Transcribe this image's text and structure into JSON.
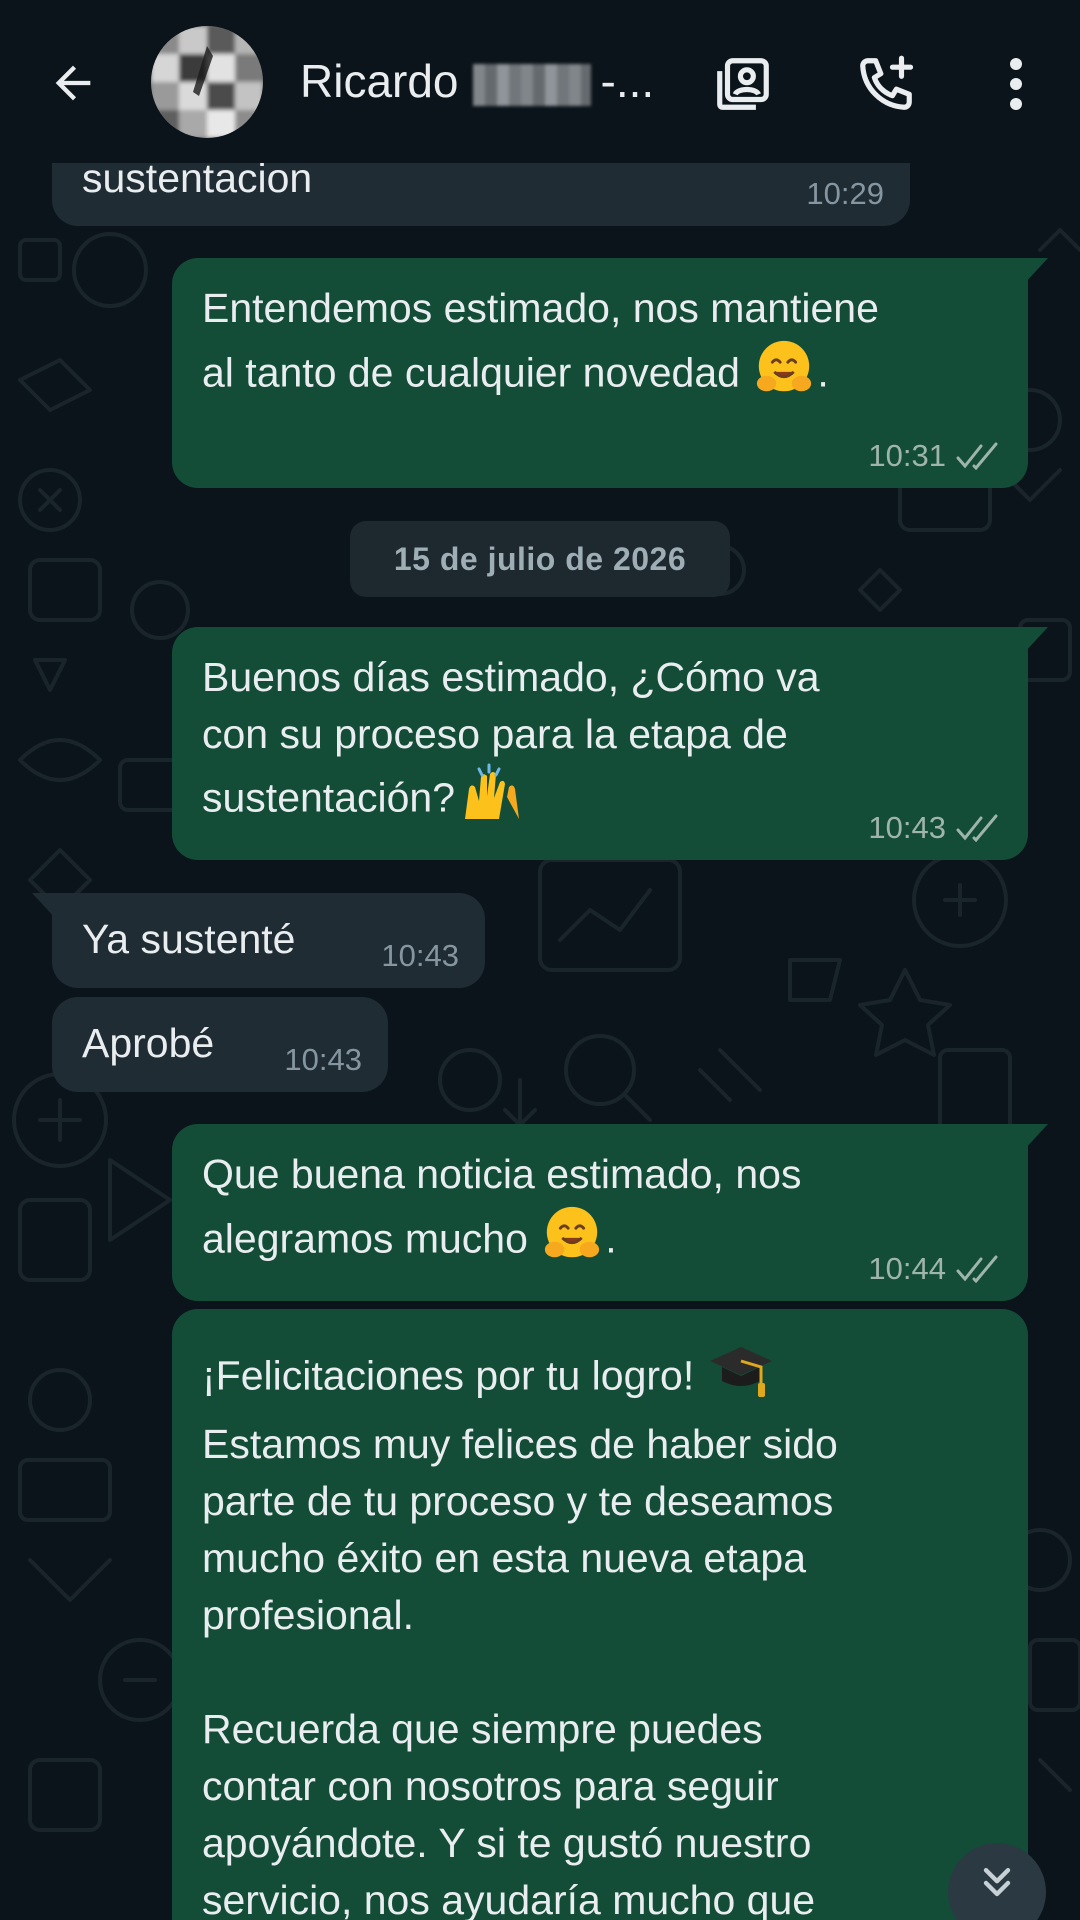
{
  "header": {
    "contact_name": "Ricardo",
    "contact_suffix": "-...",
    "back_icon": "arrow-back-icon",
    "avatar_icon": "avatar",
    "actions": [
      "contact-card-icon",
      "add-call-icon",
      "more-vert-icon"
    ]
  },
  "messages": [
    {
      "direction": "in",
      "text": "sustentacion",
      "time": "10:29"
    },
    {
      "direction": "out",
      "text_line1": "Entendemos estimado, nos mantiene",
      "text_line2": "al tanto de cualquier novedad",
      "suffix": ".",
      "time": "10:31",
      "status": "read"
    },
    {
      "direction": "out",
      "text_line1": "Buenos días estimado, ¿Cómo va",
      "text_line2": "con su proceso para la etapa de",
      "text_line3": "sustentación?",
      "time": "10:43",
      "status": "read"
    },
    {
      "direction": "in",
      "text": "Ya sustenté",
      "time": "10:43"
    },
    {
      "direction": "in",
      "text": "Aprobé",
      "time": "10:43"
    },
    {
      "direction": "out",
      "text_line1": "Que buena noticia estimado, nos",
      "text_line2": "alegramos mucho",
      "suffix": ".",
      "time": "10:44",
      "status": "read"
    },
    {
      "direction": "out",
      "text_line1": "¡Felicitaciones por tu logro!",
      "text_rest": "Estamos muy felices de haber sido\nparte de tu proceso y te deseamos\nmucho éxito en esta nueva etapa\nprofesional.\n\nRecuerda que siempre puedes\ncontar con nosotros para seguir\napoyándote. Y si te gustó nuestro\nservicio, nos ayudaría mucho que"
    }
  ],
  "date_chip": "15 de julio de 2026",
  "emojis": [
    "hugging-face-emoji",
    "raising-hands-emoji",
    "graduation-cap-emoji"
  ],
  "colors": {
    "background": "#0b141a",
    "outgoing_bubble": "#134d37",
    "incoming_bubble": "#1f2c34",
    "text": "#e9edef",
    "read_ticks": "#9fb4ab"
  },
  "scroll_button_icon": "double-chevron-down-icon"
}
